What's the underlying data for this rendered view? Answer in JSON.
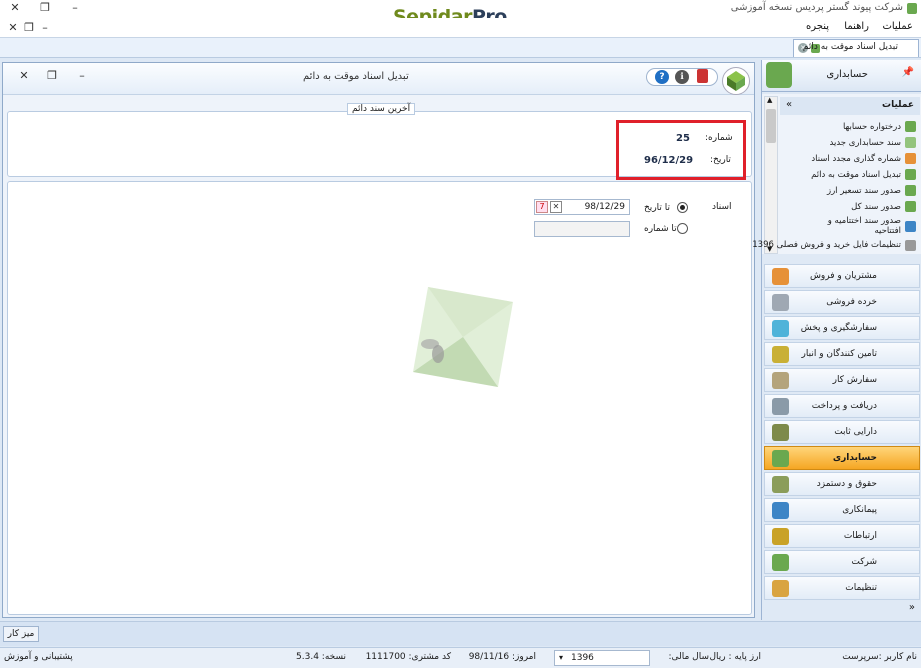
{
  "app": {
    "title": "شرکت پیوند گستر پردیس نسخه آموزشی",
    "brand_part1": "Sepidar",
    "brand_part2": "Pro"
  },
  "menubar": {
    "items": [
      "عملیات",
      "راهنما",
      "پنجره"
    ]
  },
  "doc_tab": {
    "label": "تبدیل اسناد موقت به دائم"
  },
  "window": {
    "title": "تبدیل اسناد موقت به دائم",
    "group_caption": "آخرین سند دائم",
    "last_doc_number_label": "شماره:",
    "last_doc_number": "25",
    "last_doc_date_label": "تاریخ:",
    "last_doc_date": "96/12/29",
    "documents_label": "اسناد",
    "to_date_label": "تا تاریخ",
    "to_date_value": "98/12/29",
    "to_number_label": "تا شماره",
    "to_number_value": "",
    "to_date_selected": true
  },
  "sidebar": {
    "header_title": "حسابداری",
    "ops_header": "عملیات",
    "ops": [
      {
        "label": "درختواره حسابها",
        "color": "#6aa84f"
      },
      {
        "label": "سند حسابداری جدید",
        "color": "#93c47d"
      },
      {
        "label": "شماره گذاری مجدد اسناد",
        "color": "#e69138"
      },
      {
        "label": "تبدیل اسناد موقت به دائم",
        "color": "#6aa84f"
      },
      {
        "label": "صدور سند تسعیر ارز",
        "color": "#6aa84f"
      },
      {
        "label": "صدور سند کل",
        "color": "#6aa84f"
      },
      {
        "label": "صدور سند اختتامیه و افتتاحیه",
        "color": "#3d85c6"
      },
      {
        "label": "تنظیمات فایل خرید و فروش فصلی 1396",
        "color": "#999999"
      }
    ],
    "modules": [
      {
        "label": "مشتریان و فروش",
        "color": "#e69138",
        "active": false
      },
      {
        "label": "خرده فروشی",
        "color": "#9fa8b3",
        "active": false
      },
      {
        "label": "سفارشگیری و پخش",
        "color": "#4fb3d9",
        "active": false
      },
      {
        "label": "تامین کنندگان و انبار",
        "color": "#c9b036",
        "active": false
      },
      {
        "label": "سفارش کار",
        "color": "#b4a47c",
        "active": false
      },
      {
        "label": "دریافت و پرداخت",
        "color": "#8a9aa8",
        "active": false
      },
      {
        "label": "دارایی ثابت",
        "color": "#7d8a4a",
        "active": false
      },
      {
        "label": "حسابداری",
        "color": "#6aa84f",
        "active": true
      },
      {
        "label": "حقوق و دستمزد",
        "color": "#8b9d5a",
        "active": false
      },
      {
        "label": "پیمانکاری",
        "color": "#3d85c6",
        "active": false
      },
      {
        "label": "ارتباطات",
        "color": "#c9a227",
        "active": false
      },
      {
        "label": "شرکت",
        "color": "#6aa84f",
        "active": false
      },
      {
        "label": "تنظیمات",
        "color": "#d9a441",
        "active": false
      }
    ]
  },
  "taskbar": {
    "desktop_label": "میز کار"
  },
  "status": {
    "username": "نام کاربر :سرپرست",
    "base_currency": "ارز پایه :   ریال",
    "fiscal_year_label": "سال مالی:",
    "fiscal_year": "1396",
    "today": "امروز:   98/11/16",
    "customer_code": "کد مشتری:   1111700",
    "version": "نسخه:   5.3.4",
    "support": "پشتیبانی و آموزش"
  }
}
